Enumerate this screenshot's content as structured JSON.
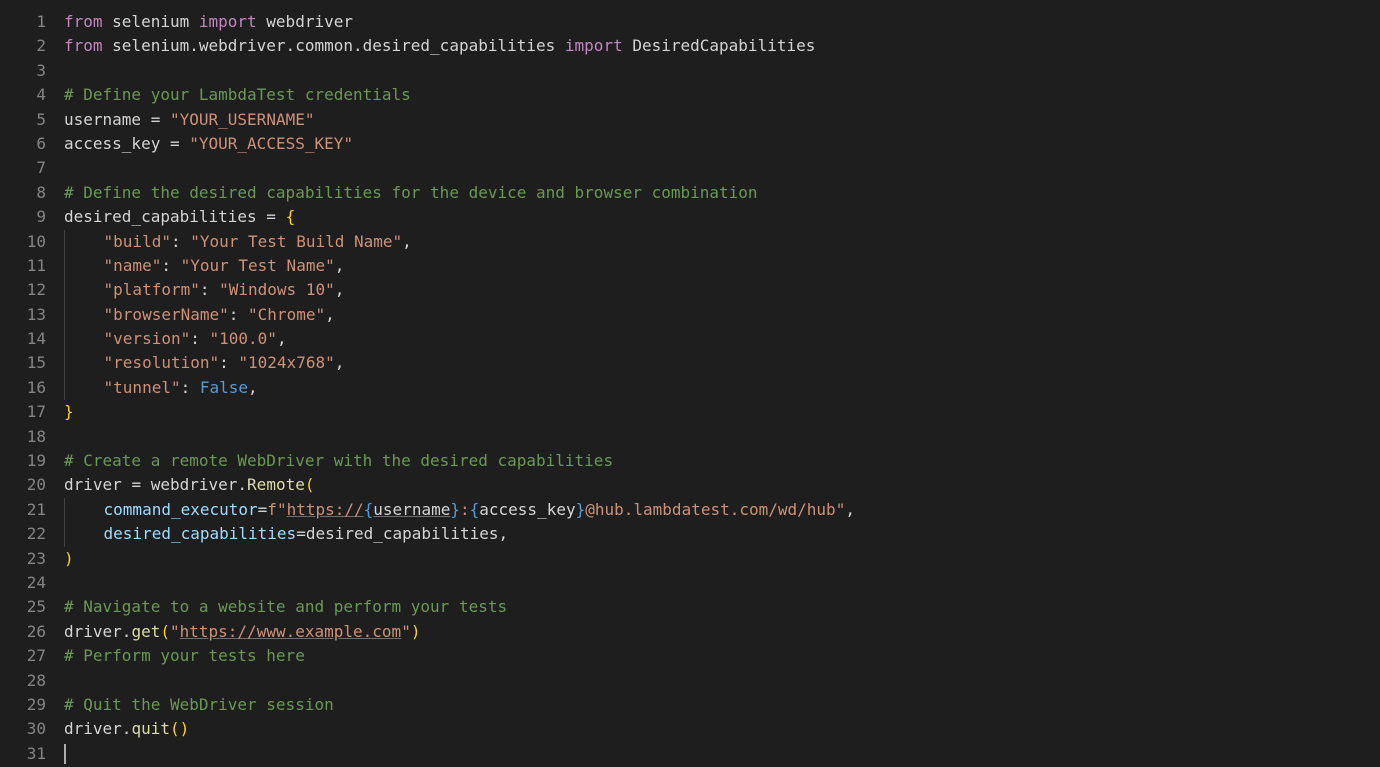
{
  "lineCount": 31,
  "tokens": {
    "l1": [
      {
        "t": "from",
        "c": "kw"
      },
      {
        "t": " selenium ",
        "c": "mod"
      },
      {
        "t": "import",
        "c": "kw"
      },
      {
        "t": " webdriver",
        "c": "mod"
      }
    ],
    "l2": [
      {
        "t": "from",
        "c": "kw"
      },
      {
        "t": " selenium.webdriver.common.desired_capabilities ",
        "c": "mod"
      },
      {
        "t": "import",
        "c": "kw"
      },
      {
        "t": " DesiredCapabilities",
        "c": "mod"
      }
    ],
    "l3": [],
    "l4": [
      {
        "t": "# Define your LambdaTest credentials",
        "c": "cmt"
      }
    ],
    "l5": [
      {
        "t": "username ",
        "c": "var"
      },
      {
        "t": "=",
        "c": "op"
      },
      {
        "t": " ",
        "c": "var"
      },
      {
        "t": "\"YOUR_USERNAME\"",
        "c": "str"
      }
    ],
    "l6": [
      {
        "t": "access_key ",
        "c": "var"
      },
      {
        "t": "=",
        "c": "op"
      },
      {
        "t": " ",
        "c": "var"
      },
      {
        "t": "\"YOUR_ACCESS_KEY\"",
        "c": "str"
      }
    ],
    "l7": [],
    "l8": [
      {
        "t": "# Define the desired capabilities for the device and browser combination",
        "c": "cmt"
      }
    ],
    "l9": [
      {
        "t": "desired_capabilities ",
        "c": "var"
      },
      {
        "t": "=",
        "c": "op"
      },
      {
        "t": " ",
        "c": "var"
      },
      {
        "t": "{",
        "c": "paren"
      }
    ],
    "l10": [
      {
        "t": "    ",
        "c": "var",
        "g": true
      },
      {
        "t": "\"build\"",
        "c": "str"
      },
      {
        "t": ": ",
        "c": "pnc"
      },
      {
        "t": "\"Your Test Build Name\"",
        "c": "str"
      },
      {
        "t": ",",
        "c": "pnc"
      }
    ],
    "l11": [
      {
        "t": "    ",
        "c": "var",
        "g": true
      },
      {
        "t": "\"name\"",
        "c": "str"
      },
      {
        "t": ": ",
        "c": "pnc"
      },
      {
        "t": "\"Your Test Name\"",
        "c": "str"
      },
      {
        "t": ",",
        "c": "pnc"
      }
    ],
    "l12": [
      {
        "t": "    ",
        "c": "var",
        "g": true
      },
      {
        "t": "\"platform\"",
        "c": "str"
      },
      {
        "t": ": ",
        "c": "pnc"
      },
      {
        "t": "\"Windows 10\"",
        "c": "str"
      },
      {
        "t": ",",
        "c": "pnc"
      }
    ],
    "l13": [
      {
        "t": "    ",
        "c": "var",
        "g": true
      },
      {
        "t": "\"browserName\"",
        "c": "str"
      },
      {
        "t": ": ",
        "c": "pnc"
      },
      {
        "t": "\"Chrome\"",
        "c": "str"
      },
      {
        "t": ",",
        "c": "pnc"
      }
    ],
    "l14": [
      {
        "t": "    ",
        "c": "var",
        "g": true
      },
      {
        "t": "\"version\"",
        "c": "str"
      },
      {
        "t": ": ",
        "c": "pnc"
      },
      {
        "t": "\"100.0\"",
        "c": "str"
      },
      {
        "t": ",",
        "c": "pnc"
      }
    ],
    "l15": [
      {
        "t": "    ",
        "c": "var",
        "g": true
      },
      {
        "t": "\"resolution\"",
        "c": "str"
      },
      {
        "t": ": ",
        "c": "pnc"
      },
      {
        "t": "\"1024x768\"",
        "c": "str"
      },
      {
        "t": ",",
        "c": "pnc"
      }
    ],
    "l16": [
      {
        "t": "    ",
        "c": "var",
        "g": true
      },
      {
        "t": "\"tunnel\"",
        "c": "str"
      },
      {
        "t": ": ",
        "c": "pnc"
      },
      {
        "t": "False",
        "c": "const"
      },
      {
        "t": ",",
        "c": "pnc"
      }
    ],
    "l17": [
      {
        "t": "}",
        "c": "paren"
      }
    ],
    "l18": [],
    "l19": [
      {
        "t": "# Create a remote WebDriver with the desired capabilities",
        "c": "cmt"
      }
    ],
    "l20": [
      {
        "t": "driver ",
        "c": "var"
      },
      {
        "t": "=",
        "c": "op"
      },
      {
        "t": " webdriver.",
        "c": "var"
      },
      {
        "t": "Remote",
        "c": "func"
      },
      {
        "t": "(",
        "c": "paren"
      }
    ],
    "l21": [
      {
        "t": "    ",
        "c": "var",
        "g": true
      },
      {
        "t": "command_executor",
        "c": "prop"
      },
      {
        "t": "=",
        "c": "op"
      },
      {
        "t": "f",
        "c": "str"
      },
      {
        "t": "\"",
        "c": "str"
      },
      {
        "t": "https://",
        "c": "str under"
      },
      {
        "t": "{",
        "c": "fbrace"
      },
      {
        "t": "username",
        "c": "var under"
      },
      {
        "t": "}",
        "c": "fbrace"
      },
      {
        "t": ":",
        "c": "str"
      },
      {
        "t": "{",
        "c": "fbrace"
      },
      {
        "t": "access_key",
        "c": "var"
      },
      {
        "t": "}",
        "c": "fbrace"
      },
      {
        "t": "@hub.lambdatest.com/wd/hub",
        "c": "str"
      },
      {
        "t": "\"",
        "c": "str"
      },
      {
        "t": ",",
        "c": "pnc"
      }
    ],
    "l22": [
      {
        "t": "    ",
        "c": "var",
        "g": true
      },
      {
        "t": "desired_capabilities",
        "c": "prop"
      },
      {
        "t": "=",
        "c": "op"
      },
      {
        "t": "desired_capabilities",
        "c": "var"
      },
      {
        "t": ",",
        "c": "pnc"
      }
    ],
    "l23": [
      {
        "t": ")",
        "c": "paren"
      }
    ],
    "l24": [],
    "l25": [
      {
        "t": "# Navigate to a website and perform your tests",
        "c": "cmt"
      }
    ],
    "l26": [
      {
        "t": "driver.",
        "c": "var"
      },
      {
        "t": "get",
        "c": "func"
      },
      {
        "t": "(",
        "c": "paren"
      },
      {
        "t": "\"",
        "c": "str"
      },
      {
        "t": "https://www.example.com",
        "c": "str under"
      },
      {
        "t": "\"",
        "c": "str"
      },
      {
        "t": ")",
        "c": "paren"
      }
    ],
    "l27": [
      {
        "t": "# Perform your tests here",
        "c": "cmt"
      }
    ],
    "l28": [],
    "l29": [
      {
        "t": "# Quit the WebDriver session",
        "c": "cmt"
      }
    ],
    "l30": [
      {
        "t": "driver.",
        "c": "var"
      },
      {
        "t": "quit",
        "c": "func"
      },
      {
        "t": "(",
        "c": "paren"
      },
      {
        "t": ")",
        "c": "paren"
      }
    ],
    "l31": []
  },
  "cursorLine": 31
}
